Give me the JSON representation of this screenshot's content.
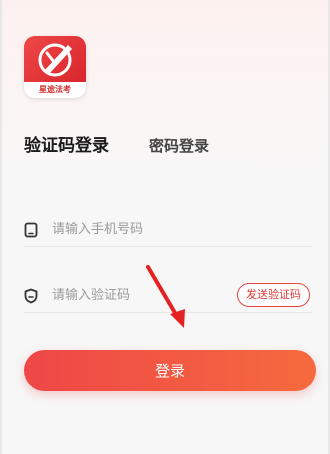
{
  "app": {
    "logo_text": "星途法考",
    "logo_icon": "law-exam-logo-icon",
    "brand_color": "#e63b3b"
  },
  "tabs": [
    {
      "label": "验证码登录",
      "active": true
    },
    {
      "label": "密码登录",
      "active": false
    }
  ],
  "phone_field": {
    "placeholder": "请输入手机号码",
    "value": "",
    "icon": "phone-icon"
  },
  "code_field": {
    "placeholder": "请输入验证码",
    "value": "",
    "icon": "shield-icon"
  },
  "send_code_label": "发送验证码",
  "login_label": "登录",
  "annotation": {
    "icon": "red-arrow-annotation",
    "color": "#e52222"
  }
}
